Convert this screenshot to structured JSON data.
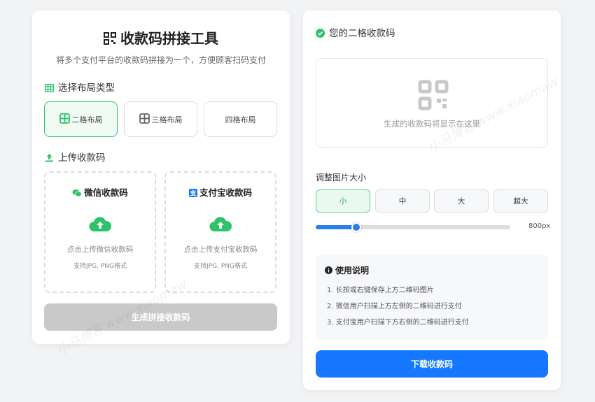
{
  "colors": {
    "green": "#2ec26a",
    "blue": "#1677ff",
    "disabled": "#c9c9c9"
  },
  "generator": {
    "title": "收款码拼接工具",
    "subtitle": "将多个支付平台的收款码拼接为一个，方便顾客扫码支付",
    "layout_section_label": "选择布局类型",
    "layouts": [
      {
        "label": "二格布局",
        "icon": "grid-2-icon",
        "selected": true
      },
      {
        "label": "三格布局",
        "icon": "grid-3-icon",
        "selected": false
      },
      {
        "label": "四格布局",
        "icon": null,
        "selected": false
      }
    ],
    "upload_section_label": "上传收款码",
    "uploads": [
      {
        "title": "微信收款码",
        "icon": "wechat-icon",
        "hint": "点击上传微信收款码",
        "formats": "支持JPG, PNG格式"
      },
      {
        "title": "支付宝收款码",
        "icon": "alipay-icon",
        "hint": "点击上传支付宝收款码",
        "formats": "支持JPG, PNG格式"
      }
    ],
    "generate_button": "生成拼接收款码"
  },
  "result": {
    "title": "您的二格收款码",
    "placeholder": "生成的收款码将显示在这里",
    "size_label": "调整图片大小",
    "sizes": [
      {
        "label": "小",
        "selected": true
      },
      {
        "label": "中",
        "selected": false
      },
      {
        "label": "大",
        "selected": false
      },
      {
        "label": "超大",
        "selected": false
      }
    ],
    "slider": {
      "value_text": "800px",
      "fraction": 0.21
    },
    "instructions": {
      "title": "使用说明",
      "items": [
        "1. 长按或右键保存上方二维码图片",
        "2. 微信用户扫描上方左侧的二维码进行支付",
        "3. 支付宝用户扫描下方右侧的二维码进行支付"
      ]
    },
    "download_button": "下载收款码"
  },
  "watermark": "小马博客 www.xiaomaw"
}
